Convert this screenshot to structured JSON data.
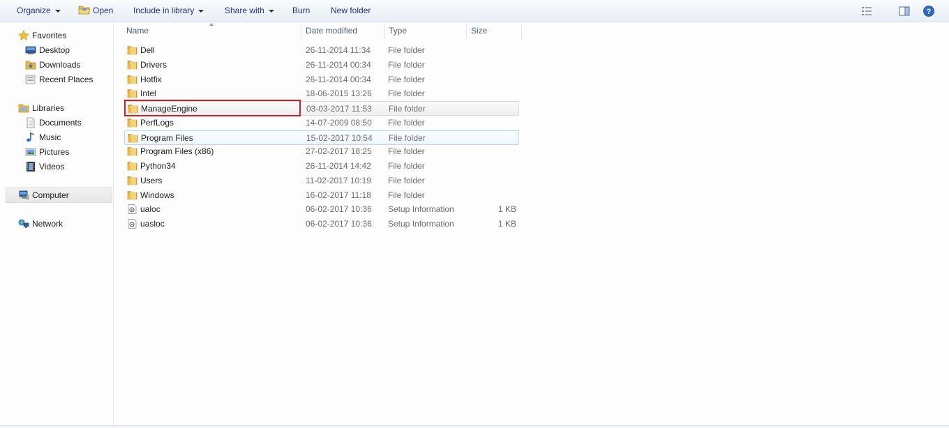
{
  "toolbar": {
    "organize": "Organize",
    "open": "Open",
    "include_in_library": "Include in library",
    "share_with": "Share with",
    "burn": "Burn",
    "new_folder": "New folder"
  },
  "nav": {
    "favorites": "Favorites",
    "desktop": "Desktop",
    "downloads": "Downloads",
    "recent_places": "Recent Places",
    "libraries": "Libraries",
    "documents": "Documents",
    "music": "Music",
    "pictures": "Pictures",
    "videos": "Videos",
    "computer": "Computer",
    "network": "Network"
  },
  "columns": {
    "name": "Name",
    "date_modified": "Date modified",
    "type": "Type",
    "size": "Size"
  },
  "files": [
    {
      "name": "Dell",
      "date": "26-11-2014 11:34",
      "type": "File folder",
      "size": ""
    },
    {
      "name": "Drivers",
      "date": "26-11-2014 00:34",
      "type": "File folder",
      "size": ""
    },
    {
      "name": "Hotfix",
      "date": "26-11-2014 00:34",
      "type": "File folder",
      "size": ""
    },
    {
      "name": "Intel",
      "date": "18-06-2015 13:26",
      "type": "File folder",
      "size": ""
    },
    {
      "name": "ManageEngine",
      "date": "03-03-2017 11:53",
      "type": "File folder",
      "size": ""
    },
    {
      "name": "PerfLogs",
      "date": "14-07-2009 08:50",
      "type": "File folder",
      "size": ""
    },
    {
      "name": "Program Files",
      "date": "15-02-2017 10:54",
      "type": "File folder",
      "size": ""
    },
    {
      "name": "Program Files (x86)",
      "date": "27-02-2017 18:25",
      "type": "File folder",
      "size": ""
    },
    {
      "name": "Python34",
      "date": "26-11-2014 14:42",
      "type": "File folder",
      "size": ""
    },
    {
      "name": "Users",
      "date": "11-02-2017 10:19",
      "type": "File folder",
      "size": ""
    },
    {
      "name": "Windows",
      "date": "16-02-2017 11:18",
      "type": "File folder",
      "size": ""
    },
    {
      "name": "ualoc",
      "date": "06-02-2017 10:36",
      "type": "Setup Information",
      "size": "1 KB"
    },
    {
      "name": "uasloc",
      "date": "06-02-2017 10:36",
      "type": "Setup Information",
      "size": "1 KB"
    }
  ],
  "colors": {
    "toolbar_text": "#1e3287",
    "highlight": "#cf1f2b",
    "selection_border": "#b8d6fb",
    "folder": "#e8b94a"
  },
  "icons": {
    "folder": "folder-icon",
    "setup_file": "setup-file-icon",
    "help": "help-icon",
    "preview_pane": "preview-pane-icon",
    "views": "views-icon"
  }
}
